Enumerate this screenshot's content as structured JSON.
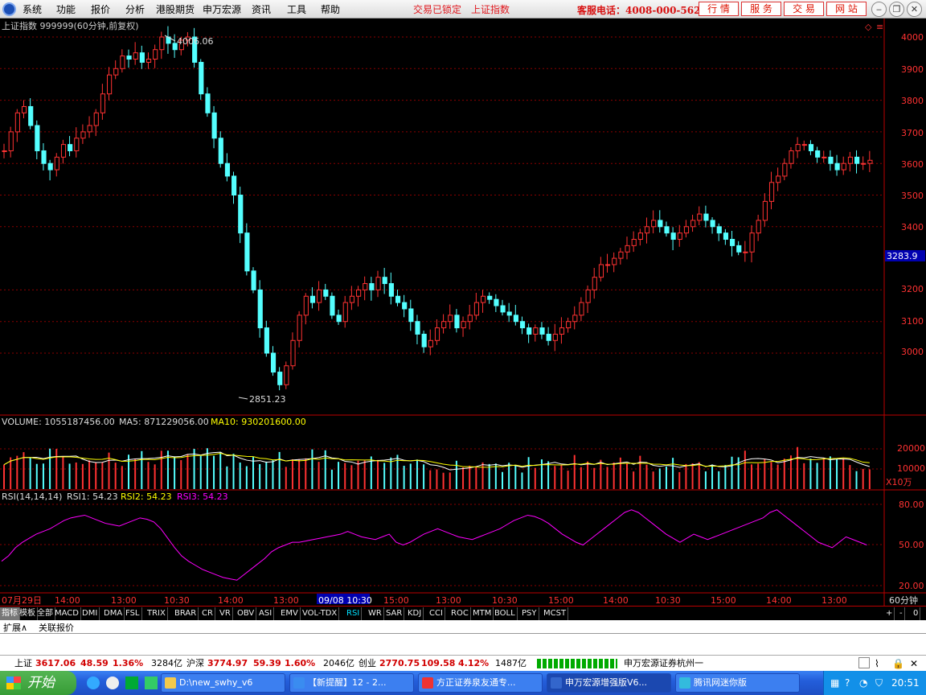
{
  "menu": {
    "items": [
      "系统",
      "功能",
      "报价",
      "分析",
      "港股期货",
      "申万宏源",
      "资讯",
      "工具",
      "帮助"
    ],
    "lock_label": "交易已锁定",
    "index_link": "上证指数",
    "hotline": "客服电话：4008-000-562",
    "buttons": [
      "行 情",
      "服 务",
      "交 易",
      "网 站"
    ]
  },
  "chart_header": {
    "title": "上证指数 999999(60分钟,前复权)",
    "high_label": "4006.06",
    "low_label": "2851.23",
    "current_price_tag": "3283.9"
  },
  "price_axis": [
    "4000",
    "3900",
    "3800",
    "3700",
    "3600",
    "3500",
    "3400",
    "3200",
    "3100",
    "3000"
  ],
  "volume_header": {
    "volume": "VOLUME: 1055187456.00",
    "ma5": "MA5: 871229056.00",
    "ma10": "MA10: 930201600.00"
  },
  "volume_axis": [
    "20000",
    "10000"
  ],
  "volume_unit": "X10万",
  "rsi_header": {
    "name": "RSI(14,14,14)",
    "rsi1": "RSI1: 54.23",
    "rsi2": "RSI2: 54.23",
    "rsi3": "RSI3: 54.23"
  },
  "rsi_axis": [
    "80.00",
    "50.00",
    "20.00"
  ],
  "time_axis": [
    "07月29日",
    "14:00",
    "13:00",
    "10:30",
    "14:00",
    "13:00",
    "09/08 10:30",
    "15:00",
    "13:00",
    "10:30",
    "15:00",
    "14:00",
    "10:30",
    "15:00",
    "14:00",
    "13:00"
  ],
  "period_label": "60分钟",
  "indicator_tabs": [
    "指标",
    "模板",
    "全部",
    "MACD",
    "DMI",
    "DMA",
    "FSL",
    "TRIX",
    "BRAR",
    "CR",
    "VR",
    "OBV",
    "ASI",
    "EMV",
    "VOL-TDX",
    "RSI",
    "WR",
    "SAR",
    "KDJ",
    "CCI",
    "ROC",
    "MTM",
    "BOLL",
    "PSY",
    "MCST"
  ],
  "active_tab": "RSI",
  "zoom_buttons": [
    "+",
    "-",
    "0"
  ],
  "ext_tabs": [
    "扩展∧",
    "关联报价"
  ],
  "status_bar": {
    "sh_label": "上证",
    "sh_price": "3617.06",
    "sh_change": "48.59",
    "sh_pct": "1.36%",
    "sh_amount": "3284亿",
    "hs_label": "沪深",
    "hs_price": "3774.97",
    "hs_change": "59.39",
    "hs_pct": "1.60%",
    "hs_amount": "2046亿",
    "cy_label": "创业",
    "cy_price": "2770.75",
    "cy_change": "109.58",
    "cy_pct": "4.12%",
    "cy_amount": "1487亿",
    "broker": "申万宏源证券杭州一"
  },
  "taskbar": {
    "start_label": "开始",
    "tasks": [
      "D:\\new_swhy_v6",
      "【新提醒】12 - 2...",
      "方正证券泉友通专...",
      "申万宏源增强版V6...",
      "腾讯网迷你版"
    ],
    "active_task": "申万宏源增强版V6...",
    "clock": "20:51"
  },
  "colors": {
    "up": "#ff3232",
    "down": "#54ffff",
    "rsi": "#ff00ff",
    "ma5": "#ffffff",
    "ma10": "#ffff00",
    "grid": "#8b0000"
  },
  "chart_data": {
    "type": "candlestick",
    "series": [
      {
        "name": "price",
        "values": [
          3640,
          3700,
          3760,
          3780,
          3720,
          3640,
          3600,
          3580,
          3620,
          3660,
          3640,
          3680,
          3700,
          3720,
          3760,
          3820,
          3880,
          3900,
          3940,
          3930,
          3950,
          3920,
          3930,
          3960,
          4000,
          3980,
          3960,
          3990,
          4000,
          3920,
          3820,
          3760,
          3680,
          3600,
          3560,
          3500,
          3380,
          3260,
          3200,
          3080,
          3000,
          2940,
          2900,
          2960,
          3040,
          3120,
          3180,
          3160,
          3200,
          3180,
          3120,
          3100,
          3160,
          3180,
          3200,
          3220,
          3200,
          3240,
          3220,
          3180,
          3160,
          3140,
          3100,
          3060,
          3020,
          3040,
          3080,
          3100,
          3120,
          3080,
          3100,
          3120,
          3160,
          3180,
          3170,
          3150,
          3130,
          3120,
          3100,
          3080,
          3060,
          3080,
          3060,
          3040,
          3060,
          3080,
          3100,
          3120,
          3160,
          3200,
          3240,
          3280,
          3280,
          3300,
          3320,
          3340,
          3360,
          3380,
          3400,
          3420,
          3400,
          3380,
          3360,
          3380,
          3400,
          3420,
          3440,
          3420,
          3400,
          3380,
          3360,
          3340,
          3320,
          3320,
          3380,
          3420,
          3480,
          3540,
          3560,
          3600,
          3640,
          3660,
          3660,
          3640,
          3620,
          3620,
          3600,
          3580,
          3600,
          3620,
          3600,
          3600,
          3610
        ]
      },
      {
        "name": "RSI1",
        "values": [
          38,
          42,
          48,
          52,
          55,
          58,
          60,
          62,
          65,
          68,
          70,
          71,
          72,
          70,
          68,
          66,
          65,
          64,
          66,
          68,
          70,
          69,
          67,
          62,
          55,
          48,
          42,
          38,
          35,
          32,
          30,
          28,
          26,
          25,
          24,
          28,
          32,
          36,
          40,
          45,
          48,
          50,
          52,
          52,
          53,
          54,
          55,
          56,
          57,
          58,
          60,
          58,
          56,
          55,
          54,
          56,
          58,
          52,
          50,
          52,
          55,
          58,
          60,
          62,
          60,
          58,
          56,
          55,
          54,
          56,
          58,
          60,
          62,
          65,
          68,
          70,
          72,
          71,
          69,
          66,
          62,
          58,
          55,
          52,
          50,
          54,
          58,
          62,
          66,
          70,
          74,
          76,
          74,
          70,
          66,
          62,
          58,
          55,
          52,
          55,
          58,
          56,
          54,
          56,
          58,
          60,
          62,
          64,
          66,
          68,
          70,
          74,
          76,
          72,
          68,
          64,
          60,
          56,
          52,
          50,
          48,
          52,
          56,
          54,
          52,
          50
        ]
      }
    ],
    "price_range": [
      2851.23,
      4006.06
    ],
    "rsi_range": [
      20,
      80
    ]
  }
}
